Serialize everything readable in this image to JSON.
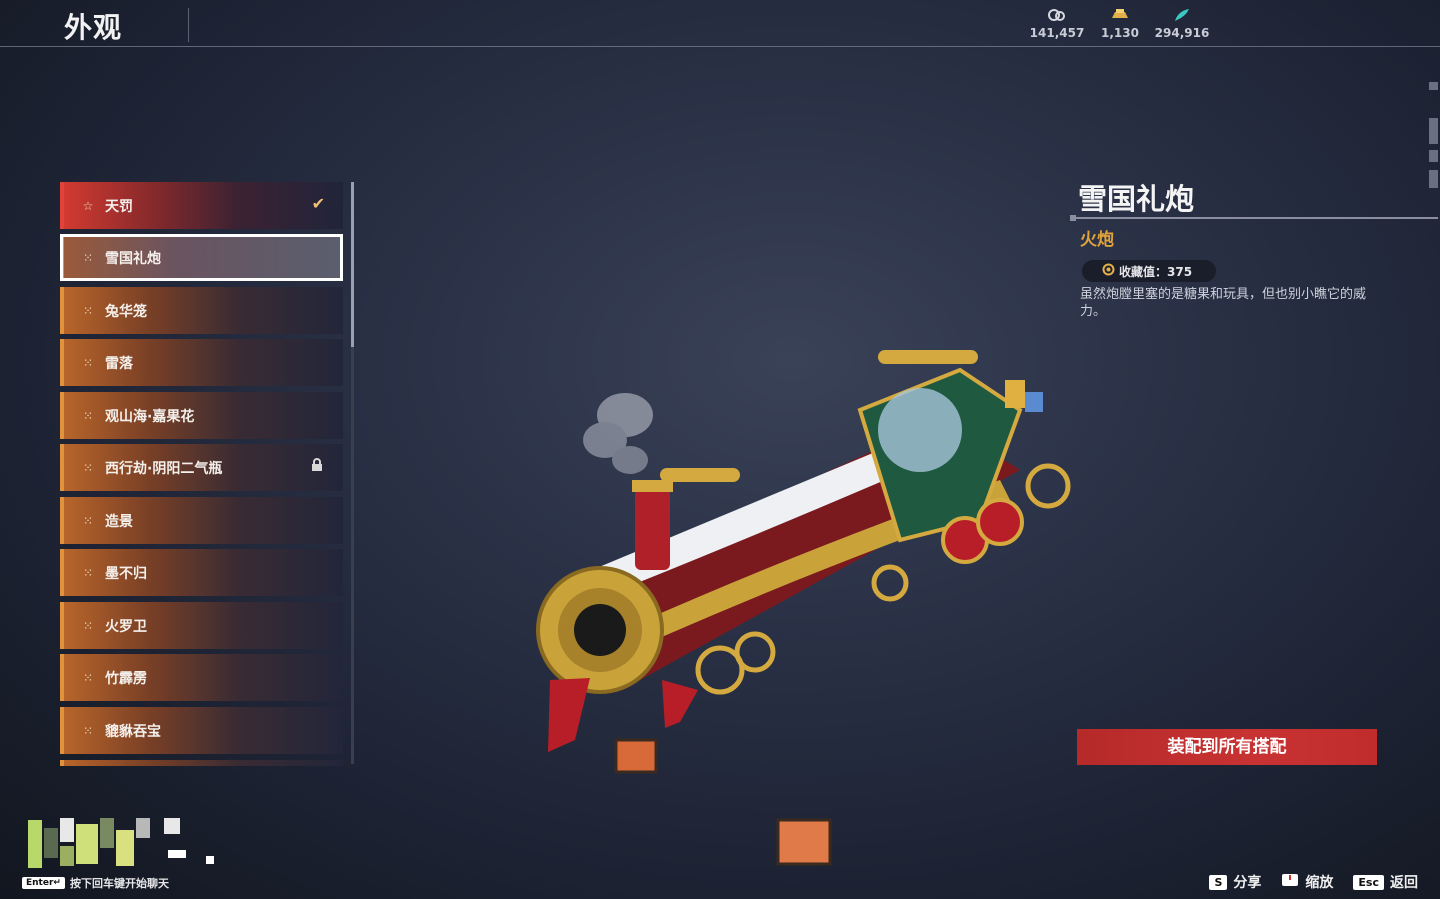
{
  "header": {
    "title": "外观",
    "currencies": [
      {
        "icon": "coin-pouch-icon",
        "value": "141,457"
      },
      {
        "icon": "gold-ingot-icon",
        "value": "1,130"
      },
      {
        "icon": "jade-feather-icon",
        "value": "294,916"
      }
    ]
  },
  "list": {
    "items": [
      {
        "label": "天罚",
        "icon": "star-icon",
        "state": "equipped"
      },
      {
        "label": "雪国礼炮",
        "icon": "dots-icon",
        "state": "selected"
      },
      {
        "label": "兔华笼",
        "icon": "dots-icon",
        "state": "normal"
      },
      {
        "label": "雷落",
        "icon": "dots-icon",
        "state": "normal"
      },
      {
        "label": "观山海·嘉果花",
        "icon": "dots-icon",
        "state": "normal"
      },
      {
        "label": "西行劫·阴阳二气瓶",
        "icon": "dots-icon",
        "state": "locked"
      },
      {
        "label": "造景",
        "icon": "dots-icon",
        "state": "normal"
      },
      {
        "label": "墨不归",
        "icon": "dots-icon",
        "state": "normal"
      },
      {
        "label": "火罗卫",
        "icon": "dots-icon",
        "state": "normal"
      },
      {
        "label": "竹霹雳",
        "icon": "dots-icon",
        "state": "normal"
      },
      {
        "label": "貔貅吞宝",
        "icon": "dots-icon",
        "state": "normal"
      }
    ]
  },
  "detail": {
    "name": "雪国礼炮",
    "type": "火炮",
    "collection_label": "收藏值：375",
    "description": "虽然炮膛里塞的是糖果和玩具，但也别小瞧它的威力。",
    "equip_button": "装配到所有搭配"
  },
  "footer": {
    "chat_key": "Enter↵",
    "chat_hint": "按下回车键开始聊天",
    "share_key": "S",
    "share_label": "分享",
    "zoom_label": "缩放",
    "back_key": "Esc",
    "back_label": "返回"
  },
  "colors": {
    "accent_orange": "#e0933c",
    "equipped_red": "#e0433a",
    "type_gold": "#e0a33a",
    "button_red": "#c83232"
  }
}
